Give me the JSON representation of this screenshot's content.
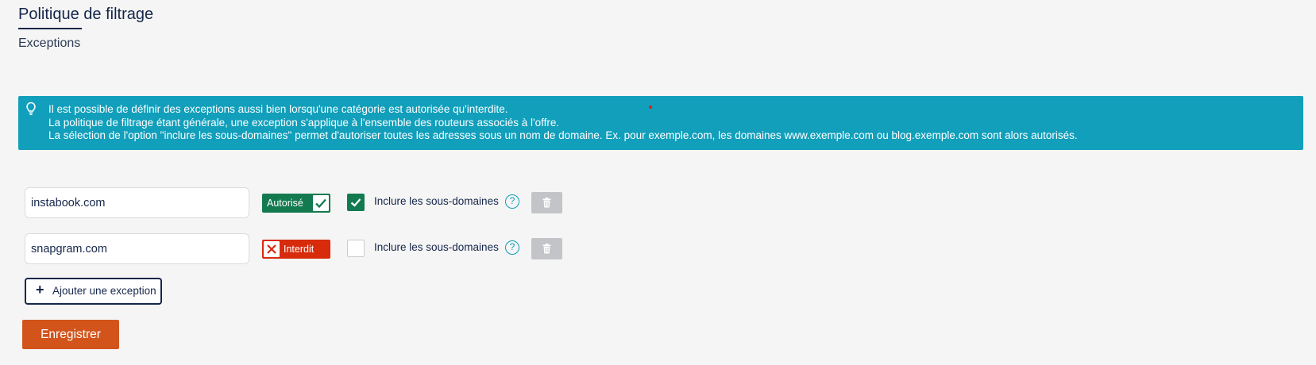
{
  "header": {
    "title": "Politique de filtrage",
    "subtitle": "Exceptions"
  },
  "info": {
    "icon": "lightbulb-icon",
    "lines": [
      "Il est possible de définir des exceptions aussi bien lorsqu'une catégorie est autorisée qu'interdite.",
      "La politique de filtrage étant générale, une exception s'applique à l'ensemble des routeurs associés à l'offre.",
      "La sélection de l'option \"inclure les sous-domaines\" permet d'autoriser toutes les adresses sous un nom de domaine. Ex. pour exemple.com, les domaines www.exemple.com ou blog.exemple.com sont alors autorisés."
    ],
    "background": "#119fbb"
  },
  "exceptions": [
    {
      "domain": "instabook.com",
      "status_label": "Autorisé",
      "status": "allowed",
      "include_subdomains": true,
      "include_label": "Inclure les sous-domaines",
      "help_icon": "question-circle-icon",
      "delete_icon": "trash-icon"
    },
    {
      "domain": "snapgram.com",
      "status_label": "Interdit",
      "status": "denied",
      "include_subdomains": false,
      "include_label": "Inclure les sous-domaines",
      "help_icon": "question-circle-icon",
      "delete_icon": "trash-icon"
    }
  ],
  "actions": {
    "add_label": "Ajouter une exception",
    "save_label": "Enregistrer"
  },
  "colors": {
    "allowed": "#137a50",
    "denied": "#d72b0c",
    "save": "#d2541b",
    "primary_text": "#15264a"
  }
}
